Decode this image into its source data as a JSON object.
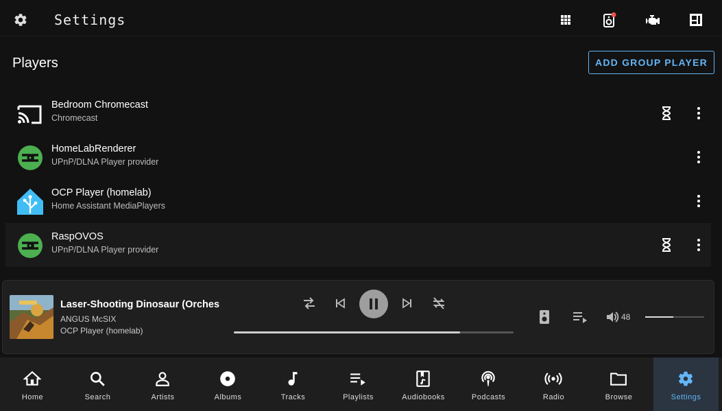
{
  "header": {
    "title": "Settings",
    "icons": [
      "apps-grid-icon",
      "speaker-notification-icon",
      "engine-icon",
      "player-card-icon"
    ]
  },
  "players_section": {
    "title": "Players",
    "add_button": "ADD GROUP PLAYER",
    "players": [
      {
        "name": "Bedroom Chromecast",
        "provider": "Chromecast",
        "icon": "cast-icon",
        "status_icon": "hourglass-icon"
      },
      {
        "name": "HomeLabRenderer",
        "provider": "UPnP/DLNA Player provider",
        "icon": "dlna-icon"
      },
      {
        "name": "OCP Player (homelab)",
        "provider": "Home Assistant MediaPlayers",
        "icon": "home-assistant-icon"
      },
      {
        "name": "RaspOVOS",
        "provider": "UPnP/DLNA Player provider",
        "icon": "dlna-icon",
        "status_icon": "hourglass-icon"
      }
    ]
  },
  "now_playing": {
    "track": "Laser-Shooting Dinosaur (Orchestral",
    "artist": "ANGUS McSIX",
    "player": "OCP Player (homelab)",
    "progress": 0.81,
    "volume": "48",
    "volume_level": 0.48
  },
  "bottom_nav": {
    "items": [
      {
        "label": "Home",
        "icon": "home-icon"
      },
      {
        "label": "Search",
        "icon": "search-icon"
      },
      {
        "label": "Artists",
        "icon": "person-icon"
      },
      {
        "label": "Albums",
        "icon": "disc-icon"
      },
      {
        "label": "Tracks",
        "icon": "music-note-icon"
      },
      {
        "label": "Playlists",
        "icon": "playlist-icon"
      },
      {
        "label": "Audiobooks",
        "icon": "audiobook-icon"
      },
      {
        "label": "Podcasts",
        "icon": "podcast-icon"
      },
      {
        "label": "Radio",
        "icon": "radio-icon"
      },
      {
        "label": "Browse",
        "icon": "folder-icon"
      },
      {
        "label": "Settings",
        "icon": "settings-icon"
      }
    ],
    "active": "Settings"
  },
  "colors": {
    "accent": "#64b5f6",
    "dlna_green": "#4caf50",
    "home_assistant_blue": "#41bdf5",
    "notification_red": "#ef5350"
  }
}
